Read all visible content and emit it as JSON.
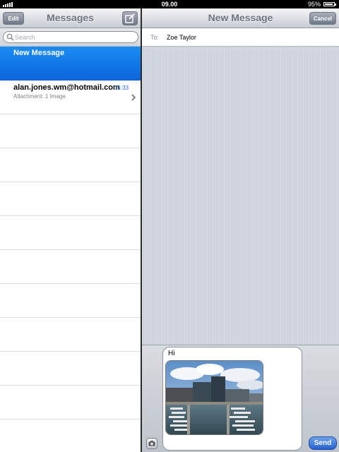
{
  "status": {
    "time": "09.00",
    "battery": "95%"
  },
  "left": {
    "title": "Messages",
    "edit_label": "Edit",
    "search_placeholder": "Search",
    "new_message_label": "New Message",
    "conversations": [
      {
        "from": "alan.jones.wm@hotmail.com",
        "time": "15:33",
        "preview": "Attachment: 1 Image"
      }
    ]
  },
  "right": {
    "title": "New Message",
    "cancel_label": "Cancel",
    "to_label": "To:",
    "to_value": "Zoe Taylor",
    "message_text": "Hi",
    "send_label": "Send"
  },
  "icons": {
    "compose": "compose-icon",
    "search": "search-icon",
    "chevron": "chevron-right-icon",
    "camera": "camera-icon"
  },
  "colors": {
    "accent": "#1a7ff0",
    "time_blue": "#2a6fd6"
  }
}
